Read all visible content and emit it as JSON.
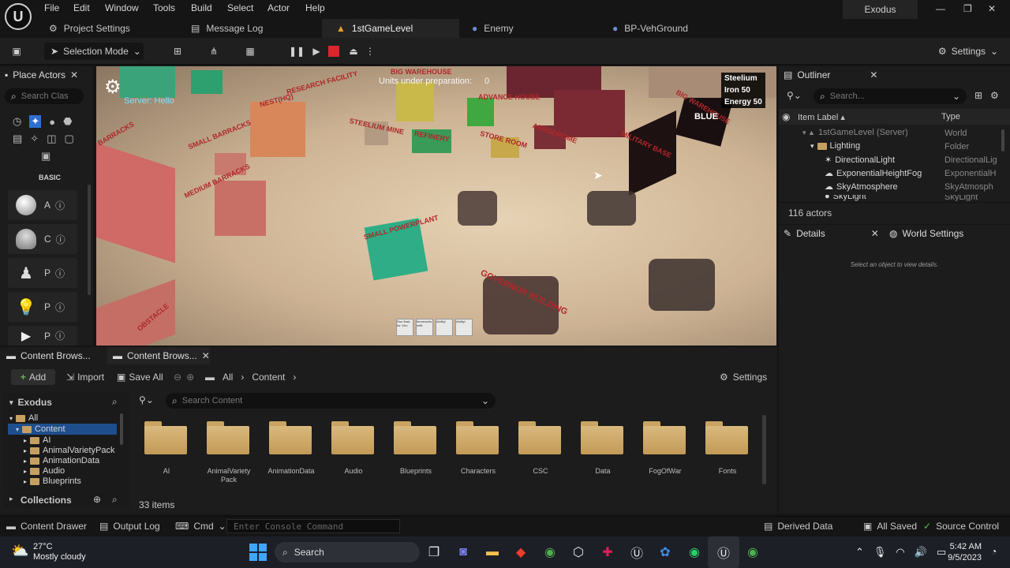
{
  "app": {
    "project_name": "Exodus"
  },
  "menu": [
    "File",
    "Edit",
    "Window",
    "Tools",
    "Build",
    "Select",
    "Actor",
    "Help"
  ],
  "window_controls": {
    "minimize": "—",
    "maximize": "❐",
    "close": "✕"
  },
  "tabs": [
    {
      "label": "Project Settings",
      "icon": "gear-icon"
    },
    {
      "label": "Message Log",
      "icon": "log-icon"
    },
    {
      "label": "1stGameLevel",
      "icon": "level-icon",
      "active": true
    },
    {
      "label": "Enemy",
      "icon": "blueprint-icon"
    },
    {
      "label": "BP-VehGround",
      "icon": "blueprint-icon"
    }
  ],
  "toolbar": {
    "selection_mode": "Selection Mode",
    "settings": "Settings"
  },
  "place_actors": {
    "title": "Place Actors",
    "search_placeholder": "Search Clas",
    "category": "BASIC",
    "items": [
      {
        "letter": "A"
      },
      {
        "letter": "C"
      },
      {
        "letter": "P"
      },
      {
        "letter": "P"
      },
      {
        "letter": "P"
      }
    ]
  },
  "viewport": {
    "server_text": "Server: Hello",
    "units_label": "Units under preparation:",
    "units_value": "0",
    "resources": [
      "Steelium",
      "Iron 50",
      "Energy 50"
    ],
    "team": "BLUE",
    "labels": [
      "BIG WAREHOUSE",
      "RESEARCH FACILITY",
      "NEST(HQ)",
      "ADVANCE HOUSE",
      "STEELIUM MINE",
      "REFINERY",
      "STORE ROOM",
      "AERODROME",
      "BARRACKS",
      "SMALL BARRACKS",
      "MEDIUM BARRACKS",
      "SMALL POWERPLANT",
      "GOVERNOR BUILDING",
      "BIG WAREHOUSE",
      "MILITARY BASE",
      "OBSTACLE"
    ],
    "hud_buttons": [
      "Run flask for 10m",
      "Items/units refill",
      "Abilityl",
      "Abilityl"
    ]
  },
  "outliner": {
    "title": "Outliner",
    "search_placeholder": "Search...",
    "col_label": "Item Label",
    "col_type": "Type",
    "rows": [
      {
        "label": "1stGameLevel (Server)",
        "type": "World"
      },
      {
        "label": "Lighting",
        "type": "Folder"
      },
      {
        "label": "DirectionalLight",
        "type": "DirectionalLig"
      },
      {
        "label": "ExponentialHeightFog",
        "type": "ExponentialH"
      },
      {
        "label": "SkyAtmosphere",
        "type": "SkyAtmosph"
      },
      {
        "label": "SkyLight",
        "type": "SkyLight"
      }
    ],
    "count": "116 actors"
  },
  "details": {
    "title": "Details",
    "world_settings": "World Settings",
    "empty_text": "Select an object to view details."
  },
  "content_browser": {
    "tabs": [
      "Content Brows...",
      "Content Brows..."
    ],
    "add": "Add",
    "import": "Import",
    "save_all": "Save All",
    "path": [
      "All",
      "Content"
    ],
    "settings": "Settings",
    "tree_root": "Exodus",
    "tree": [
      "All",
      "Content",
      "AI",
      "AnimalVarietyPack",
      "AnimationData",
      "Audio",
      "Blueprints"
    ],
    "collections": "Collections",
    "search_placeholder": "Search Content",
    "folders": [
      "AI",
      "AnimalVariety Pack",
      "AnimationData",
      "Audio",
      "Blueprints",
      "Characters",
      "CSC",
      "Data",
      "FogOfWar",
      "Fonts"
    ],
    "item_count": "33 items"
  },
  "statusbar": {
    "content_drawer": "Content Drawer",
    "output_log": "Output Log",
    "cmd": "Cmd",
    "console_placeholder": "Enter Console Command",
    "derived_data": "Derived Data",
    "all_saved": "All Saved",
    "source_control": "Source Control"
  },
  "taskbar": {
    "temp": "27°C",
    "weather": "Mostly cloudy",
    "search": "Search",
    "time": "5:42 AM",
    "date": "9/5/2023"
  }
}
